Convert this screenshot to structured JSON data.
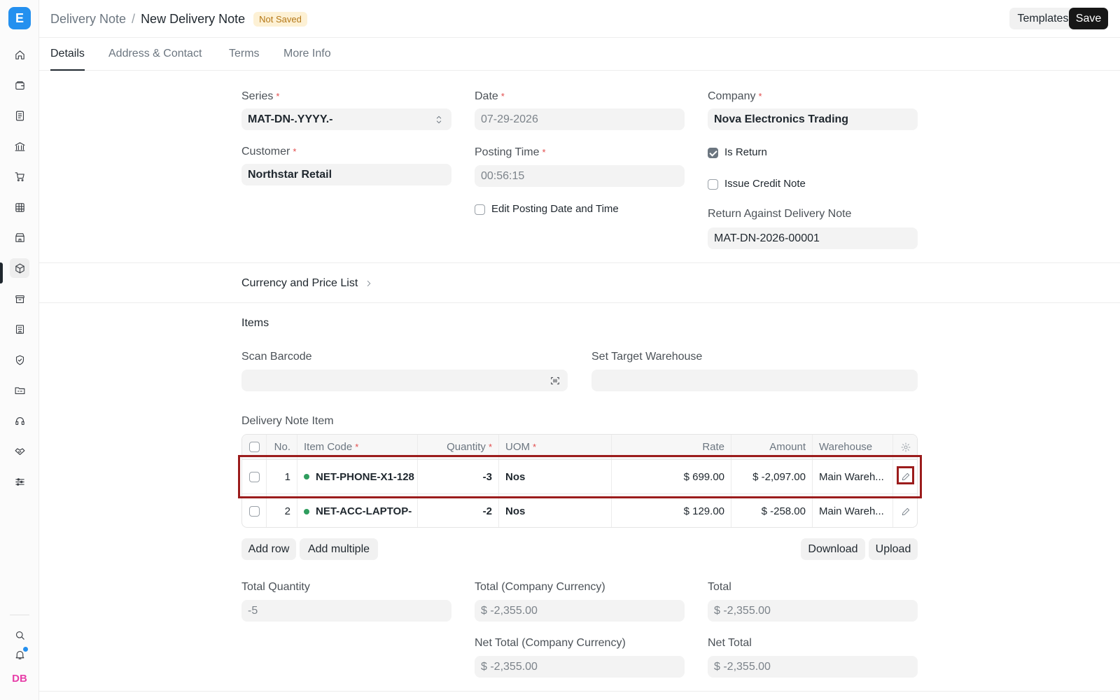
{
  "app": {
    "logo_letter": "E",
    "user_initials": "DB"
  },
  "breadcrumb": {
    "parent": "Delivery Note",
    "separator": "/",
    "current": "New Delivery Note",
    "status": "Not Saved"
  },
  "actions": {
    "templates": "Templates",
    "save": "Save"
  },
  "tabs": [
    "Details",
    "Address & Contact",
    "Terms",
    "More Info"
  ],
  "form": {
    "series": {
      "label": "Series",
      "value": "MAT-DN-.YYYY.-"
    },
    "date": {
      "label": "Date",
      "value": "07-29-2026"
    },
    "company": {
      "label": "Company",
      "value": "Nova Electronics Trading"
    },
    "customer": {
      "label": "Customer",
      "value": "Northstar Retail"
    },
    "posting_time": {
      "label": "Posting Time",
      "value": "00:56:15"
    },
    "is_return": {
      "label": "Is Return",
      "checked": true
    },
    "issue_credit_note": {
      "label": "Issue Credit Note",
      "checked": false
    },
    "edit_posting": {
      "label": "Edit Posting Date and Time",
      "checked": false
    },
    "return_against": {
      "label": "Return Against Delivery Note",
      "value": "MAT-DN-2026-00001"
    }
  },
  "currency_section": {
    "label": "Currency and Price List"
  },
  "items_section": {
    "title": "Items",
    "scan_barcode_label": "Scan Barcode",
    "set_target_warehouse_label": "Set Target Warehouse",
    "table_title": "Delivery Note Item",
    "columns": {
      "no": "No.",
      "item_code": "Item Code",
      "quantity": "Quantity",
      "uom": "UOM",
      "rate": "Rate",
      "amount": "Amount",
      "warehouse": "Warehouse"
    },
    "rows": [
      {
        "no": "1",
        "item_code": "NET-PHONE-X1-128",
        "quantity": "-3",
        "uom": "Nos",
        "rate": "$ 699.00",
        "amount": "$ -2,097.00",
        "warehouse": "Main Wareh..."
      },
      {
        "no": "2",
        "item_code": "NET-ACC-LAPTOP-",
        "quantity": "-2",
        "uom": "Nos",
        "rate": "$ 129.00",
        "amount": "$ -258.00",
        "warehouse": "Main Wareh..."
      }
    ],
    "buttons": {
      "add_row": "Add row",
      "add_multiple": "Add multiple",
      "download": "Download",
      "upload": "Upload"
    }
  },
  "totals": {
    "total_quantity": {
      "label": "Total Quantity",
      "value": "-5"
    },
    "total_company": {
      "label": "Total (Company Currency)",
      "value": "$ -2,355.00"
    },
    "total": {
      "label": "Total",
      "value": "$ -2,355.00"
    },
    "net_total_company": {
      "label": "Net Total (Company Currency)",
      "value": "$ -2,355.00"
    },
    "net_total": {
      "label": "Net Total",
      "value": "$ -2,355.00"
    }
  },
  "colors": {
    "accent": "#2490ef",
    "highlight": "#9b1c1c",
    "status_bg": "#fdf1d5",
    "status_text": "#b57817"
  }
}
